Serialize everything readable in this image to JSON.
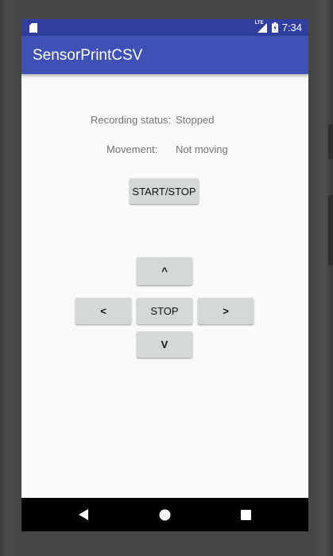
{
  "status_bar": {
    "time": "7:34",
    "network_label": "LTE",
    "icons": [
      "sd-card-icon",
      "signal-icon",
      "battery-icon"
    ]
  },
  "app_bar": {
    "title": "SensorPrintCSV"
  },
  "main": {
    "recording_status_label": "Recording status:",
    "recording_status_value": "Stopped",
    "movement_label": "Movement:",
    "movement_value": "Not moving",
    "start_stop_label": "START/STOP",
    "controls": {
      "up_label": "^",
      "left_label": "<",
      "stop_label": "STOP",
      "right_label": ">",
      "down_label": "V"
    }
  },
  "nav_bar": {
    "icons": [
      "back-icon",
      "home-icon",
      "recents-icon"
    ]
  },
  "colors": {
    "status_bar": "#303f9f",
    "app_bar": "#3f51b5",
    "button": "#d6d7d7",
    "background": "#fafafa"
  }
}
